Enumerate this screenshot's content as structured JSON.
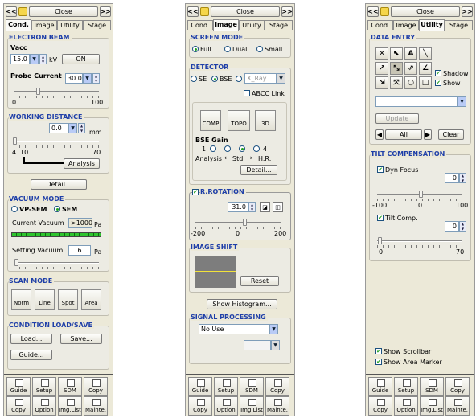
{
  "nav": {
    "prev": "<<",
    "next": ">>",
    "close": "Close"
  },
  "tabs": [
    "Cond.",
    "Image",
    "Utility",
    "Stage"
  ],
  "p1": {
    "electron_beam": "ELECTRON BEAM",
    "vacc_label": "Vacc",
    "vacc_value": "15.0",
    "vacc_unit": "kV",
    "on_button": "ON",
    "probe_current_label": "Probe Current",
    "probe_current_value": "30.0",
    "probe_min": "0",
    "probe_max": "100",
    "working_distance": "WORKING DISTANCE",
    "wd_value": "0.0",
    "wd_unit": "mm",
    "wd_min": "4",
    "wd_mid": "10",
    "wd_max": "70",
    "analysis_button": "Analysis",
    "detail_button": "Detail...",
    "vacuum_mode": "VACUUM MODE",
    "vpsem": "VP-SEM",
    "sem": "SEM",
    "current_vacuum_label": "Current Vacuum",
    "current_vacuum_value": ">10000",
    "pa": "Pa",
    "setting_vacuum_label": "Setting Vacuum",
    "setting_vacuum_value": "6",
    "scan_mode": "SCAN MODE",
    "scan_buttons": [
      "Norm",
      "Line",
      "Spot",
      "Area"
    ],
    "condition_load_save": "CONDITION LOAD/SAVE",
    "load_button": "Load...",
    "save_button": "Save...",
    "guide_button": "Guide..."
  },
  "p2": {
    "screen_mode": "SCREEN MODE",
    "full": "Full",
    "dual": "Dual",
    "small": "Small",
    "detector": "DETECTOR",
    "se": "SE",
    "bse": "BSE",
    "xray": "X_Ray",
    "abcc_link": "ABCC Link",
    "comp": "COMP",
    "topo": "TOPO",
    "three_d": "3D",
    "bse_gain": "BSE Gain",
    "gain_1": "1",
    "gain_4": "4",
    "analysis": "Analysis",
    "std": "Std.",
    "hr": "H.R.",
    "detail_button": "Detail...",
    "r_rotation": "R.ROTATION",
    "rotation_value": "31.0",
    "rot_min": "-200",
    "rot_mid": "0",
    "rot_max": "200",
    "image_shift": "IMAGE SHIFT",
    "reset_button": "Reset",
    "show_histogram": "Show Histogram...",
    "signal_processing": "SIGNAL PROCESSING",
    "signal_value": "No Use"
  },
  "p3": {
    "data_entry": "DATA ENTRY",
    "shadow": "Shadow",
    "show": "Show",
    "update_button": "Update",
    "all_button": "All",
    "clear_button": "Clear",
    "tilt_compensation": "TILT COMPENSATION",
    "dyn_focus": "Dyn Focus",
    "dyn_value": "0",
    "dyn_min": "-100",
    "dyn_mid": "0",
    "dyn_max": "100",
    "tilt_comp": "Tilt Comp.",
    "tilt_value": "0",
    "tilt_min": "0",
    "tilt_max": "70",
    "show_scrollbar": "Show Scrollbar",
    "show_area_marker": "Show Area Marker"
  },
  "bottom": {
    "row1": [
      "Guide",
      "Setup",
      "SDM",
      "Copy"
    ],
    "row2": [
      "Copy",
      "Option",
      "Img.List",
      "Mainte."
    ]
  },
  "colors": {
    "section_header": "#1f3fa8",
    "panel_bg": "#ece9d8",
    "vacuum_bar": "#2ec42e"
  }
}
